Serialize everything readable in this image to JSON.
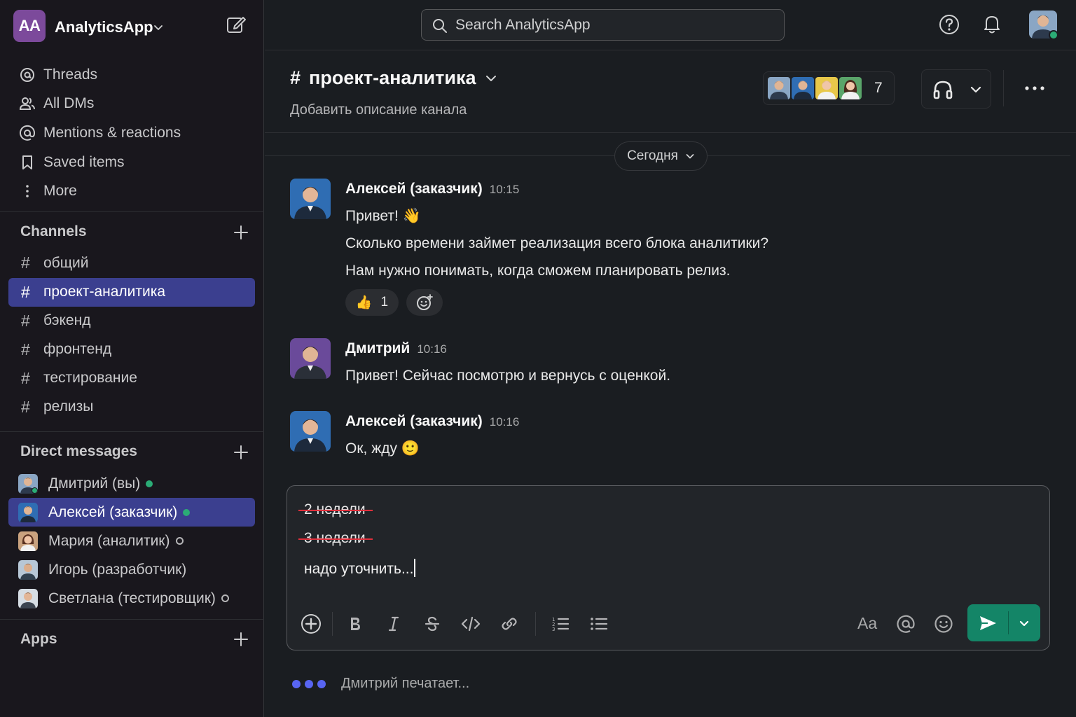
{
  "workspace": {
    "logo_text": "AA",
    "name": "AnalyticsApp"
  },
  "nav": [
    {
      "label": "Threads",
      "icon": "threads-icon"
    },
    {
      "label": "All DMs",
      "icon": "people-icon"
    },
    {
      "label": "Mentions & reactions",
      "icon": "at-icon"
    },
    {
      "label": "Saved items",
      "icon": "bookmark-icon"
    },
    {
      "label": "More",
      "icon": "vertical-dots-icon"
    }
  ],
  "channels": {
    "heading": "Channels",
    "items": [
      {
        "name": "общий",
        "active": false
      },
      {
        "name": "проект-аналитика",
        "active": true
      },
      {
        "name": "бэкенд",
        "active": false
      },
      {
        "name": "фронтенд",
        "active": false
      },
      {
        "name": "тестирование",
        "active": false
      },
      {
        "name": "релизы",
        "active": false
      }
    ]
  },
  "dms": {
    "heading": "Direct messages",
    "items": [
      {
        "name": "Дмитрий (вы)",
        "status": "online",
        "active": false
      },
      {
        "name": "Алексей (заказчик)",
        "status": "online",
        "active": true
      },
      {
        "name": "Мария (аналитик)",
        "status": "away",
        "active": false
      },
      {
        "name": "Игорь (разработчик)",
        "status": "none",
        "active": false
      },
      {
        "name": "Светлана (тестировщик)",
        "status": "away",
        "active": false
      }
    ]
  },
  "apps": {
    "heading": "Apps"
  },
  "search": {
    "placeholder": "Search AnalyticsApp"
  },
  "channel": {
    "hash": "#",
    "name": "проект-аналитика",
    "description": "Добавить описание канала",
    "member_count": "7"
  },
  "date_divider": "Сегодня",
  "messages": [
    {
      "author": "Алексей (заказчик)",
      "time": "10:15",
      "lines": [
        "Привет! 👋",
        "Сколько времени займет реализация всего блока аналитики?",
        "Нам нужно понимать, когда сможем планировать релиз."
      ],
      "reaction": {
        "emoji": "👍",
        "count": "1"
      }
    },
    {
      "author": "Дмитрий",
      "time": "10:16",
      "lines": [
        "Привет! Сейчас посмотрю и вернусь с оценкой."
      ]
    },
    {
      "author": "Алексей (заказчик)",
      "time": "10:16",
      "lines": [
        "Ок, жду 🙂"
      ]
    }
  ],
  "composer": {
    "struck_lines": [
      "2 недели",
      "3 недели"
    ],
    "current_text": "надо уточнить...",
    "format_label": "Aa"
  },
  "typing": "Дмитрий печатает...",
  "colors": {
    "accent": "#3b3f8f",
    "send": "#148567",
    "online": "#2bac76",
    "strike": "#e0303c"
  }
}
